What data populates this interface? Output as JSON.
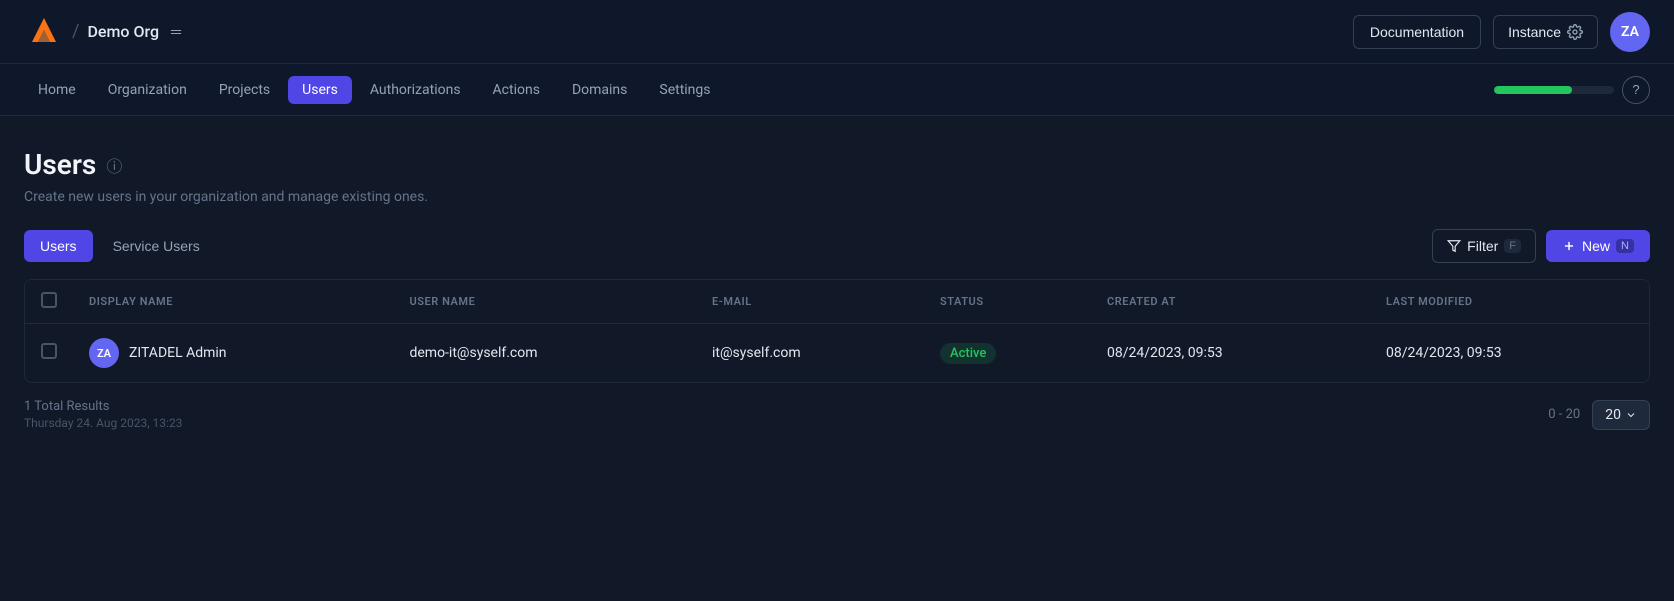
{
  "app": {
    "logo_text": "Z",
    "org_name": "Demo Org",
    "breadcrumb_sep": "/"
  },
  "top_nav": {
    "documentation_label": "Documentation",
    "instance_label": "Instance",
    "avatar_initials": "ZA"
  },
  "sec_nav": {
    "links": [
      {
        "id": "home",
        "label": "Home",
        "active": false
      },
      {
        "id": "organization",
        "label": "Organization",
        "active": false
      },
      {
        "id": "projects",
        "label": "Projects",
        "active": false
      },
      {
        "id": "users",
        "label": "Users",
        "active": true
      },
      {
        "id": "authorizations",
        "label": "Authorizations",
        "active": false
      },
      {
        "id": "actions",
        "label": "Actions",
        "active": false
      },
      {
        "id": "domains",
        "label": "Domains",
        "active": false
      },
      {
        "id": "settings",
        "label": "Settings",
        "active": false
      }
    ],
    "progress_percent": 65,
    "help_label": "?"
  },
  "page": {
    "title": "Users",
    "subtitle": "Create new users in your organization and manage existing ones."
  },
  "tabs": [
    {
      "id": "users",
      "label": "Users",
      "active": true
    },
    {
      "id": "service-users",
      "label": "Service Users",
      "active": false
    }
  ],
  "toolbar": {
    "filter_label": "Filter",
    "filter_shortcut": "F",
    "new_label": "New",
    "new_shortcut": "N"
  },
  "table": {
    "columns": [
      {
        "id": "checkbox",
        "label": ""
      },
      {
        "id": "display_name",
        "label": "Display Name"
      },
      {
        "id": "user_name",
        "label": "User Name"
      },
      {
        "id": "email",
        "label": "E-Mail"
      },
      {
        "id": "status",
        "label": "Status"
      },
      {
        "id": "created_at",
        "label": "Created At"
      },
      {
        "id": "last_modified",
        "label": "Last Modified"
      }
    ],
    "rows": [
      {
        "avatar_initials": "ZA",
        "display_name": "ZITADEL Admin",
        "user_name": "demo-it@syself.com",
        "email": "it@syself.com",
        "status": "Active",
        "created_at": "08/24/2023, 09:53",
        "last_modified": "08/24/2023, 09:53"
      }
    ]
  },
  "footer": {
    "total_label": "1 Total Results",
    "date_label": "Thursday 24. Aug 2023, 13:23",
    "page_range": "0 - 20",
    "per_page": "20"
  }
}
